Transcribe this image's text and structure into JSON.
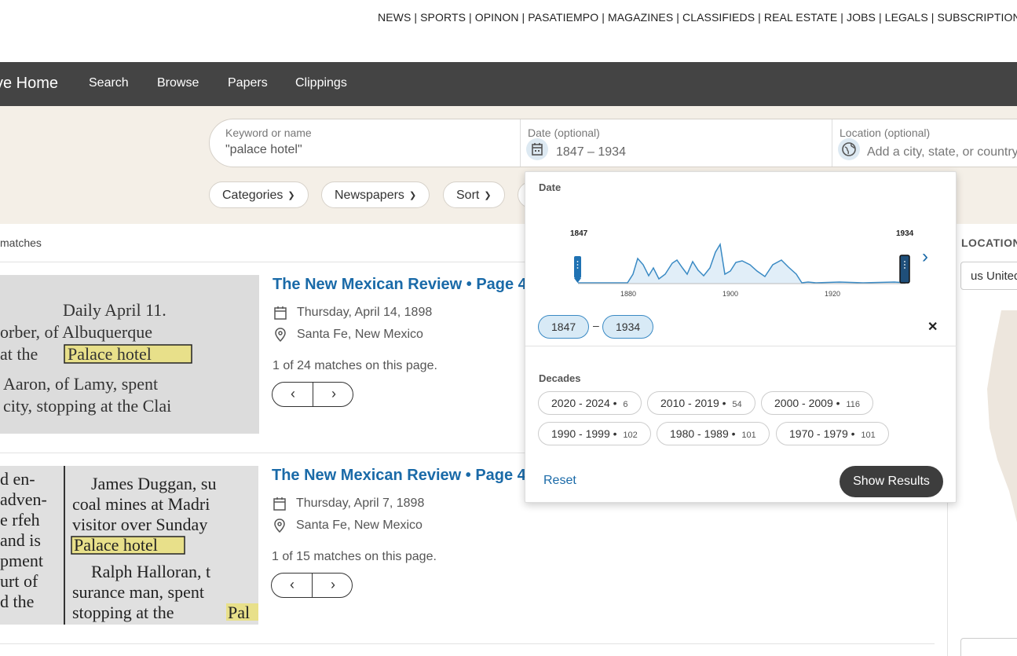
{
  "top_nav": {
    "text": "NEWS | SPORTS | OPINON | PASATIEMPO | MAGAZINES | CLASSIFIEDS | REAL ESTATE | JOBS | LEGALS | SUBSCRIPTIONS"
  },
  "main_nav": {
    "brand": "ve Home",
    "links": [
      "Search",
      "Browse",
      "Papers",
      "Clippings"
    ]
  },
  "search": {
    "keyword_label": "Keyword or name",
    "keyword_value": "\"palace hotel\"",
    "date_label": "Date (optional)",
    "date_value": "1847 – 1934",
    "location_label": "Location (optional)",
    "location_placeholder": "Add a city, state, or country"
  },
  "filters": {
    "categories": "Categories",
    "newspapers": "Newspapers",
    "sort": "Sort"
  },
  "matches_text": "matches",
  "results": [
    {
      "title": "The New Mexican Review • Page 4",
      "date": "Thursday, April 14, 1898",
      "location": "Santa Fe, New Mexico",
      "matches": "1 of 24 matches on this page.",
      "snippet": [
        "Daily April 11.",
        "orber, of Albuquerque",
        "at the",
        "Palace hotel",
        "Aaron, of Lamy, spent",
        "city, stopping at the Clai"
      ]
    },
    {
      "title": "The New Mexican Review • Page 4",
      "date": "Thursday, April 7, 1898",
      "location": "Santa Fe, New Mexico",
      "matches": "1 of 15 matches on this page.",
      "snippet": [
        "James Duggan, su",
        "coal mines at Madri",
        "visitor over Sunday",
        "Palace hotel",
        "Ralph Halloran, t",
        "surance man, spent",
        "stopping at the",
        "Pal"
      ],
      "snippet_left": [
        "d en-",
        "adven-",
        "e rfeh",
        "and is",
        "pment",
        "urt of",
        "d the"
      ]
    }
  ],
  "sidebar": {
    "location_heading": "LOCATION",
    "location_select": "us United"
  },
  "date_popup": {
    "title": "Date",
    "start_marker": "1847",
    "end_marker": "1934",
    "x_ticks": [
      "1880",
      "1900",
      "1920"
    ],
    "start_chip": "1847",
    "dash": "–",
    "end_chip": "1934",
    "decades_title": "Decades",
    "decades": [
      {
        "label": "2020 - 2024",
        "count": "6"
      },
      {
        "label": "2010 - 2019",
        "count": "54"
      },
      {
        "label": "2000 - 2009",
        "count": "116"
      },
      {
        "label": "1990 - 1999",
        "count": "102"
      },
      {
        "label": "1980 - 1989",
        "count": "101"
      },
      {
        "label": "1970 - 1979",
        "count": "101"
      }
    ],
    "reset": "Reset",
    "show_results": "Show Results"
  }
}
